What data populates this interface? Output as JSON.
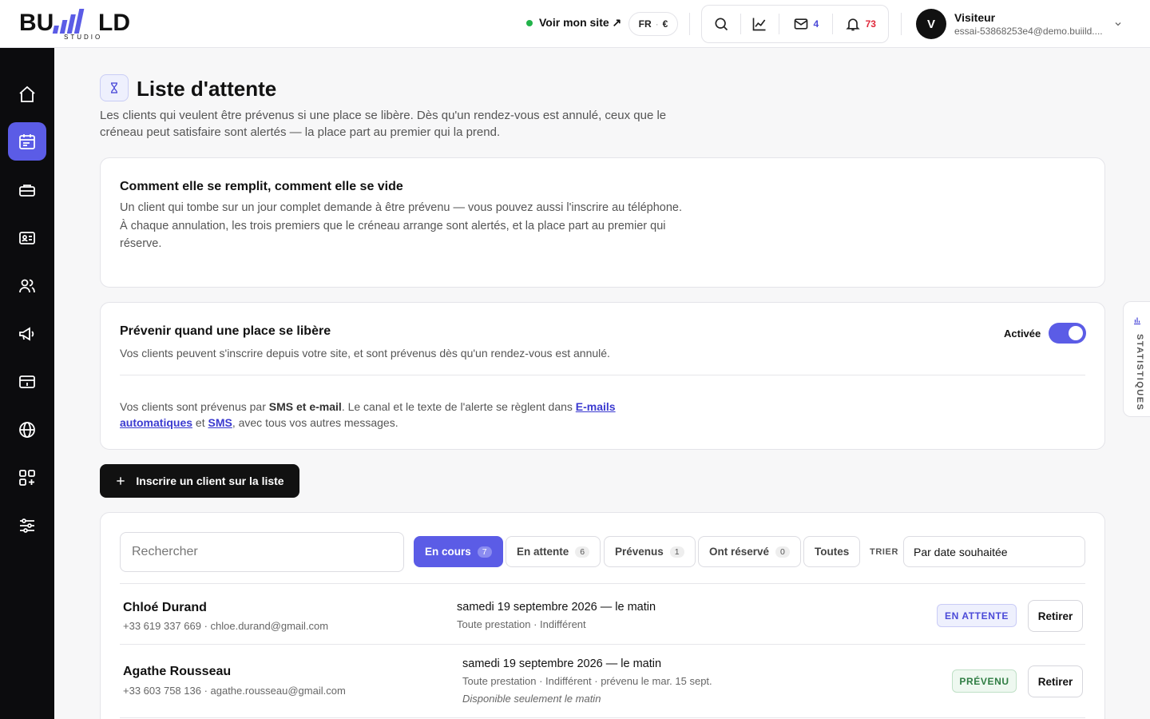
{
  "brand": {
    "name": "BUILD",
    "sub": "STUDIO"
  },
  "topbar": {
    "site_link": "Voir mon site ↗",
    "lang": "FR",
    "currency": "€",
    "mail_count": "4",
    "notif_count": "73"
  },
  "user": {
    "initial": "V",
    "name": "Visiteur",
    "email": "essai-53868253e4@demo.buiild...."
  },
  "page": {
    "title": "Liste d'attente",
    "description": "Les clients qui veulent être prévenus si une place se libère. Dès qu'un rendez-vous est annulé, ceux que le créneau peut satisfaire sont alertés — la place part au premier qui la prend."
  },
  "how_card": {
    "title": "Comment elle se remplit, comment elle se vide",
    "text": "Un client qui tombe sur un jour complet demande à être prévenu — vous pouvez aussi l'inscrire au téléphone. À chaque annulation, les trois premiers que le créneau arrange sont alertés, et la place part au premier qui réserve."
  },
  "notify_card": {
    "title": "Prévenir quand une place se libère",
    "text": "Vos clients peuvent s'inscrire depuis votre site, et sont prévenus dès qu'un rendez-vous est annulé.",
    "toggle_label": "Activée",
    "note_1": "Vos clients sont prévenus par ",
    "note_channels": "SMS et e-mail",
    "note_2": ". Le canal et le texte de l'alerte se règlent dans ",
    "note_link1": "E-mails automatiques",
    "note_3": " et ",
    "note_link2": "SMS",
    "note_4": ", avec tous vos autres messages."
  },
  "add_button": "Inscrire un client sur la liste",
  "list": {
    "search_placeholder": "Rechercher",
    "filters": [
      {
        "label": "En cours",
        "count": "7"
      },
      {
        "label": "En attente",
        "count": "6"
      },
      {
        "label": "Prévenus",
        "count": "1"
      },
      {
        "label": "Ont réservé",
        "count": "0"
      },
      {
        "label": "Toutes"
      }
    ],
    "sort_label": "TRIER",
    "sort_value": "Par date souhaitée",
    "remove_label": "Retirer",
    "rows": [
      {
        "name": "Chloé Durand",
        "contact": "+33 619 337 669 · chloe.durand@gmail.com",
        "date": "samedi 19 septembre 2026 — le matin",
        "detail": "Toute prestation · Indifférent",
        "status": "EN ATTENTE"
      },
      {
        "name": "Agathe Rousseau",
        "contact": "+33 603 758 136 · agathe.rousseau@gmail.com",
        "date": "samedi 19 septembre 2026 — le matin",
        "detail": "Toute prestation · Indifférent · prévenu le mar. 15 sept.",
        "note": "Disponible seulement le matin",
        "status": "PRÉVENU"
      }
    ]
  },
  "stats_tab": "STATISTIQUES",
  "colors": {
    "accent": "#5b5ce6",
    "sidebar": "#0c0c0e",
    "green": "#22b34a",
    "red": "#e0283a"
  }
}
